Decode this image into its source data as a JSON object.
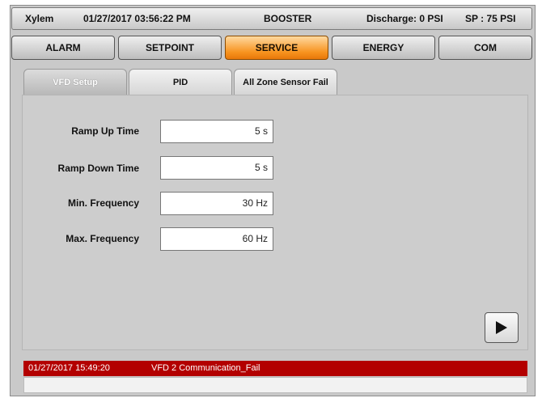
{
  "status_bar": {
    "brand": "Xylem",
    "datetime": "01/27/2017 03:56:22 PM",
    "mode": "BOOSTER",
    "discharge": "Discharge: 0 PSI",
    "setpoint": "SP : 75 PSI"
  },
  "nav": {
    "items": [
      {
        "label": "ALARM"
      },
      {
        "label": "SETPOINT"
      },
      {
        "label": "SERVICE"
      },
      {
        "label": "ENERGY"
      },
      {
        "label": "COM"
      }
    ],
    "active": "SERVICE"
  },
  "subtabs": {
    "items": [
      {
        "label": "VFD Setup"
      },
      {
        "label": "PID"
      },
      {
        "label": "All Zone Sensor Fail"
      }
    ],
    "active": "VFD Setup"
  },
  "vfd_setup": {
    "ramp_up": {
      "label": "Ramp Up Time",
      "value": "5 s"
    },
    "ramp_down": {
      "label": "Ramp Down Time",
      "value": "5 s"
    },
    "min_freq": {
      "label": "Min. Frequency",
      "value": "30 Hz"
    },
    "max_freq": {
      "label": "Max. Frequency",
      "value": "60 Hz"
    }
  },
  "next_button": {
    "icon": "play-right-icon"
  },
  "alarm": {
    "timestamp": "01/27/2017 15:49:20",
    "message": "VFD 2 Communication_Fail",
    "color": "#b30000"
  },
  "colors": {
    "active_tab": "#f7931e",
    "alarm": "#b30000"
  }
}
